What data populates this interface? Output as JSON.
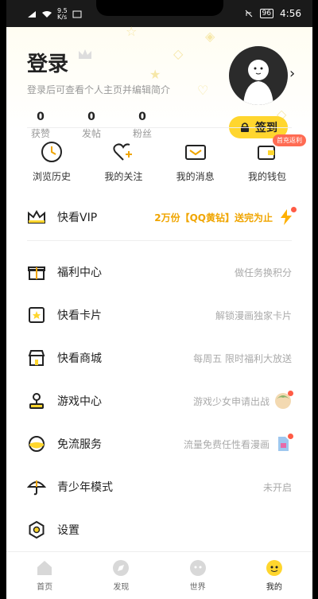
{
  "status_bar": {
    "signal_small_top": "9.5",
    "signal_small_bottom": "K/s",
    "battery": "96",
    "time": "4:56"
  },
  "header": {
    "title": "登录",
    "subtitle": "登录后可查看个人主页并编辑简介",
    "chevron": "›"
  },
  "stats": [
    {
      "value": "0",
      "label": "获赞"
    },
    {
      "value": "0",
      "label": "发帖"
    },
    {
      "value": "0",
      "label": "粉丝"
    }
  ],
  "checkin": {
    "label": "签到"
  },
  "quick_actions": [
    {
      "label": "浏览历史",
      "icon": "clock-icon"
    },
    {
      "label": "我的关注",
      "icon": "heart-plus-icon"
    },
    {
      "label": "我的消息",
      "icon": "envelope-icon"
    },
    {
      "label": "我的钱包",
      "icon": "wallet-icon",
      "badge": "首充返利"
    }
  ],
  "vip": {
    "label": "快看VIP",
    "promo": "2万份【QQ黄钻】送完为止"
  },
  "menu": [
    {
      "label": "福利中心",
      "hint": "做任务换积分",
      "icon": "gift-icon"
    },
    {
      "label": "快看卡片",
      "hint": "解锁漫画独家卡片",
      "icon": "card-icon"
    },
    {
      "label": "快看商城",
      "hint": "每周五 限时福利大放送",
      "icon": "shop-icon"
    },
    {
      "label": "游戏中心",
      "hint": "游戏少女申请出战",
      "icon": "joystick-icon"
    },
    {
      "label": "免流服务",
      "hint": "流量免费任性看漫画",
      "icon": "data-icon"
    },
    {
      "label": "青少年模式",
      "hint": "未开启",
      "icon": "umbrella-icon"
    },
    {
      "label": "设置",
      "hint": "",
      "icon": "settings-icon"
    }
  ],
  "tabs": [
    {
      "label": "首页",
      "icon": "home-icon"
    },
    {
      "label": "发现",
      "icon": "discover-icon"
    },
    {
      "label": "世界",
      "icon": "world-icon"
    },
    {
      "label": "我的",
      "icon": "me-icon",
      "active": true
    }
  ],
  "colors": {
    "accent": "#ffd62e",
    "promo": "#f0a500",
    "badge": "#ff6b53"
  }
}
